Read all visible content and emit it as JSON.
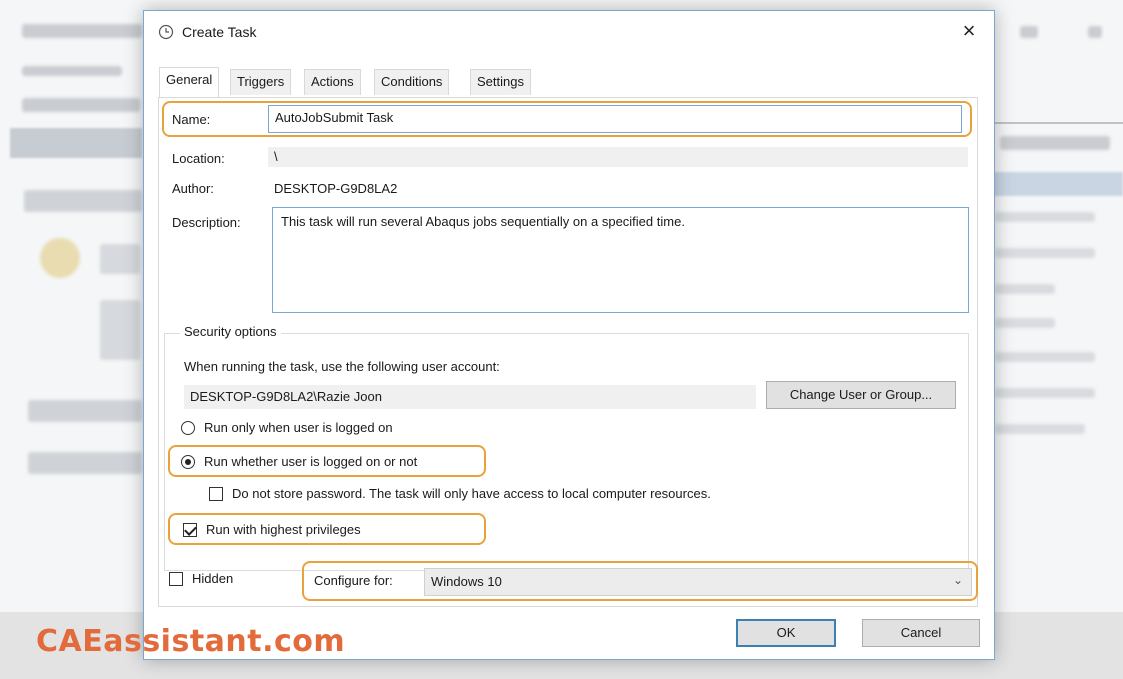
{
  "dialog": {
    "title": "Create Task",
    "close_label": "×",
    "tabs": [
      {
        "label": "General",
        "active": true
      },
      {
        "label": "Triggers"
      },
      {
        "label": "Actions"
      },
      {
        "label": "Conditions"
      },
      {
        "label": "Settings"
      }
    ],
    "general": {
      "name_label": "Name:",
      "name_value": "AutoJobSubmit Task",
      "location_label": "Location:",
      "location_value": "\\",
      "author_label": "Author:",
      "author_value": "DESKTOP-G9D8LA2",
      "description_label": "Description:",
      "description_value": "This task will run several Abaqus jobs sequentially on a specified time.",
      "security": {
        "legend": "Security options",
        "account_prompt": "When running the task, use the following user account:",
        "account_value": "DESKTOP-G9D8LA2\\Razie Joon",
        "change_button": "Change User or Group...",
        "radio_logged_on": "Run only when user is logged on",
        "radio_whether": "Run whether user is logged on or not",
        "radio_selected": "whether",
        "no_store_password": "Do not store password.  The task will only have access to local computer resources.",
        "no_store_checked": false,
        "highest_privileges": "Run with highest privileges",
        "highest_checked": true
      },
      "hidden_label": "Hidden",
      "hidden_checked": false,
      "configure_label": "Configure for:",
      "configure_value": "Windows 10"
    },
    "ok_label": "OK",
    "cancel_label": "Cancel"
  },
  "watermark": "CAEassistant.com",
  "highlight_color": "#e8a33c"
}
